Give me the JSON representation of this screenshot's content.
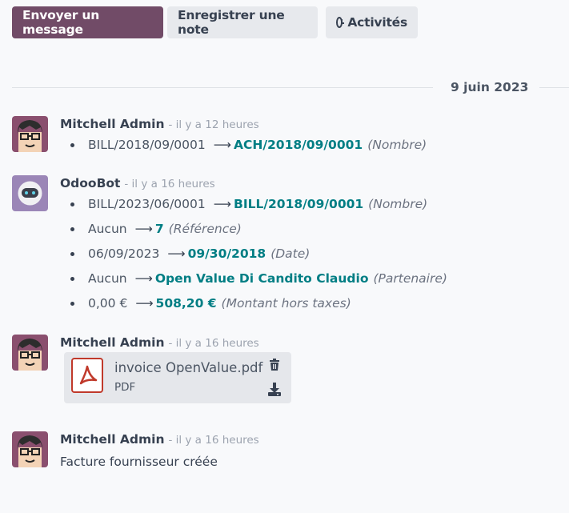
{
  "toolbar": {
    "send_message": "Envoyer un message",
    "log_note": "Enregistrer une note",
    "activities": "Activités"
  },
  "date_separator": "9 juin 2023",
  "messages": [
    {
      "author": "Mitchell Admin",
      "time": "- il y a 12 heures",
      "changes": [
        {
          "old": "BILL/2018/09/0001",
          "new": "ACH/2018/09/0001",
          "field": "(Nombre)"
        }
      ]
    },
    {
      "author": "OdooBot",
      "time": "- il y a 16 heures",
      "changes": [
        {
          "old": "BILL/2023/06/0001",
          "new": "BILL/2018/09/0001",
          "field": "(Nombre)"
        },
        {
          "old": "Aucun",
          "new": "7",
          "field": "(Référence)"
        },
        {
          "old": "06/09/2023",
          "new": "09/30/2018",
          "field": "(Date)"
        },
        {
          "old": "Aucun",
          "new": "Open Value Di Candito Claudio",
          "field": "(Partenaire)"
        },
        {
          "old": "0,00 €",
          "new": "508,20 €",
          "field": "(Montant hors taxes)"
        }
      ]
    },
    {
      "author": "Mitchell Admin",
      "time": "- il y a 16 heures",
      "attachment": {
        "name": "invoice OpenValue.pdf",
        "type": "PDF"
      }
    },
    {
      "author": "Mitchell Admin",
      "time": "- il y a 16 heures",
      "text": "Facture fournisseur créée"
    }
  ],
  "colors": {
    "primary": "#714b67",
    "link": "#017e84"
  }
}
